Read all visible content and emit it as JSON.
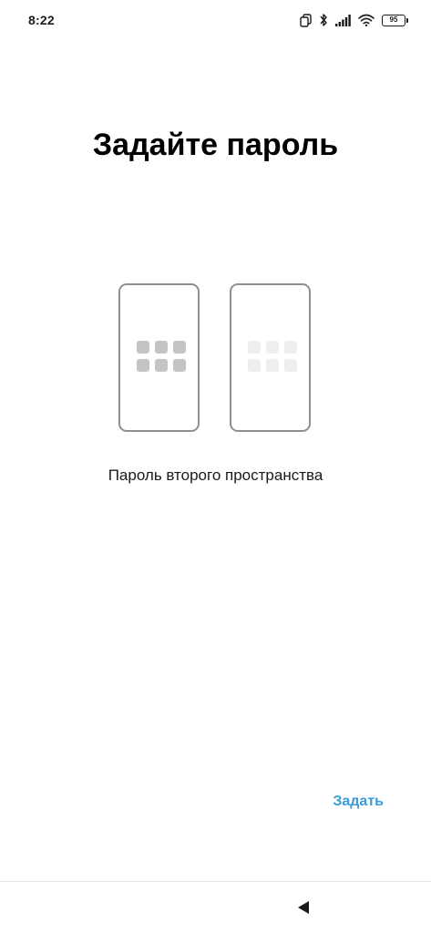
{
  "status_bar": {
    "time": "8:22",
    "battery_level": "95",
    "icons": [
      "dual-app-icon",
      "bluetooth-icon",
      "signal-icon",
      "wifi-icon",
      "battery-icon"
    ]
  },
  "page": {
    "title": "Задайте пароль",
    "subtitle": "Пароль второго пространства"
  },
  "illustration": {
    "icons": [
      "phone-first-space-icon",
      "phone-second-space-icon"
    ],
    "grid_colors": {
      "first_space": "#c4c4c4",
      "second_space": "#eeeeee"
    }
  },
  "actions": {
    "set_label": "Задать",
    "accent_color": "#3a9bd9"
  },
  "navigation": {
    "icons": [
      "back-icon"
    ]
  }
}
